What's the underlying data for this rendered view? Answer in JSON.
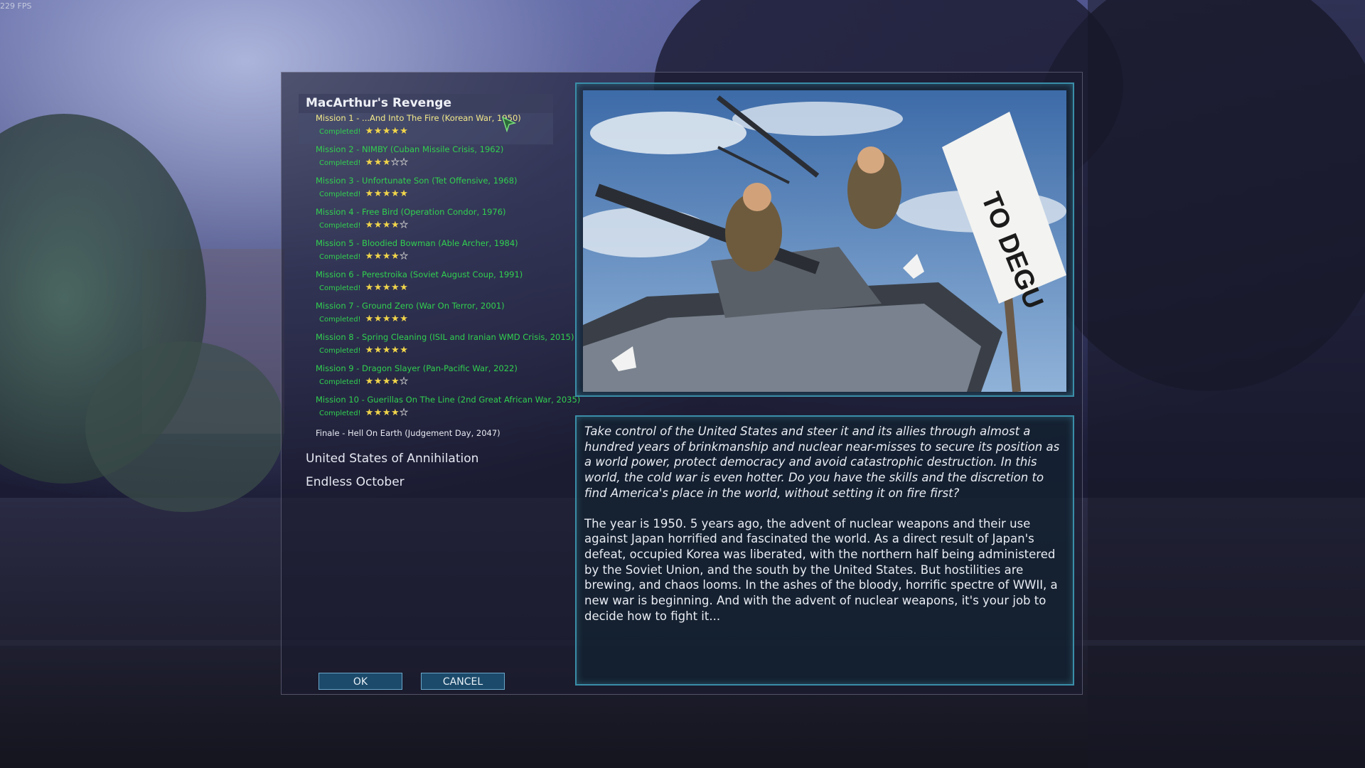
{
  "fps": "229 FPS",
  "campaign": {
    "title": "MacArthur's Revenge",
    "missions": [
      {
        "name": "Mission 1 - ...And Into The Fire (Korean War, 1950)",
        "status": "Completed!",
        "stars": 5,
        "selected": true
      },
      {
        "name": "Mission 2 - NIMBY (Cuban Missile Crisis, 1962)",
        "status": "Completed!",
        "stars": 3
      },
      {
        "name": "Mission 3 - Unfortunate Son (Tet Offensive, 1968)",
        "status": "Completed!",
        "stars": 5
      },
      {
        "name": "Mission 4 - Free Bird (Operation Condor, 1976)",
        "status": "Completed!",
        "stars": 4
      },
      {
        "name": "Mission 5 - Bloodied Bowman (Able Archer, 1984)",
        "status": "Completed!",
        "stars": 4
      },
      {
        "name": "Mission 6 - Perestroika (Soviet August Coup, 1991)",
        "status": "Completed!",
        "stars": 5
      },
      {
        "name": "Mission 7 - Ground Zero (War On Terror, 2001)",
        "status": "Completed!",
        "stars": 5
      },
      {
        "name": "Mission 8 - Spring Cleaning (ISIL and Iranian WMD Crisis, 2015)",
        "status": "Completed!",
        "stars": 5
      },
      {
        "name": "Mission 9 - Dragon Slayer (Pan-Pacific War, 2022)",
        "status": "Completed!",
        "stars": 4
      },
      {
        "name": "Mission 10 - Guerillas On The Line (2nd Great African War, 2035)",
        "status": "Completed!",
        "stars": 4
      }
    ],
    "finale": "Finale - Hell On Earth (Judgement Day, 2047)"
  },
  "other_campaigns": [
    "United States of Annihilation",
    "Endless October"
  ],
  "buttons": {
    "ok": "OK",
    "cancel": "CANCEL"
  },
  "image": {
    "sign_text": "TO DEGU"
  },
  "description": {
    "intro": "Take control of the United States and steer it and its allies through almost a hundred years of brinkmanship and nuclear near-misses to secure its position as a world power, protect democracy and avoid catastrophic destruction. In this world, the cold war is even hotter. Do you have the skills and the discretion to find America's place in the world, without setting it on fire first?",
    "body": "The year is 1950. 5 years ago, the advent of nuclear weapons and their use against Japan horrified and fascinated the world. As a direct result of Japan's defeat, occupied Korea was liberated, with the northern half being administered by the Soviet Union, and the south by the United States. But hostilities are brewing, and chaos looms. In the ashes of the bloody, horrific spectre of WWII, a new war is beginning. And with the advent of nuclear weapons, it's your job to decide how to fight it..."
  },
  "colors": {
    "mission_green": "#31d04f",
    "selected_yellow": "#f3e98a",
    "panel_border": "#3a8ea8",
    "button_fill": "#1c4a6a"
  }
}
